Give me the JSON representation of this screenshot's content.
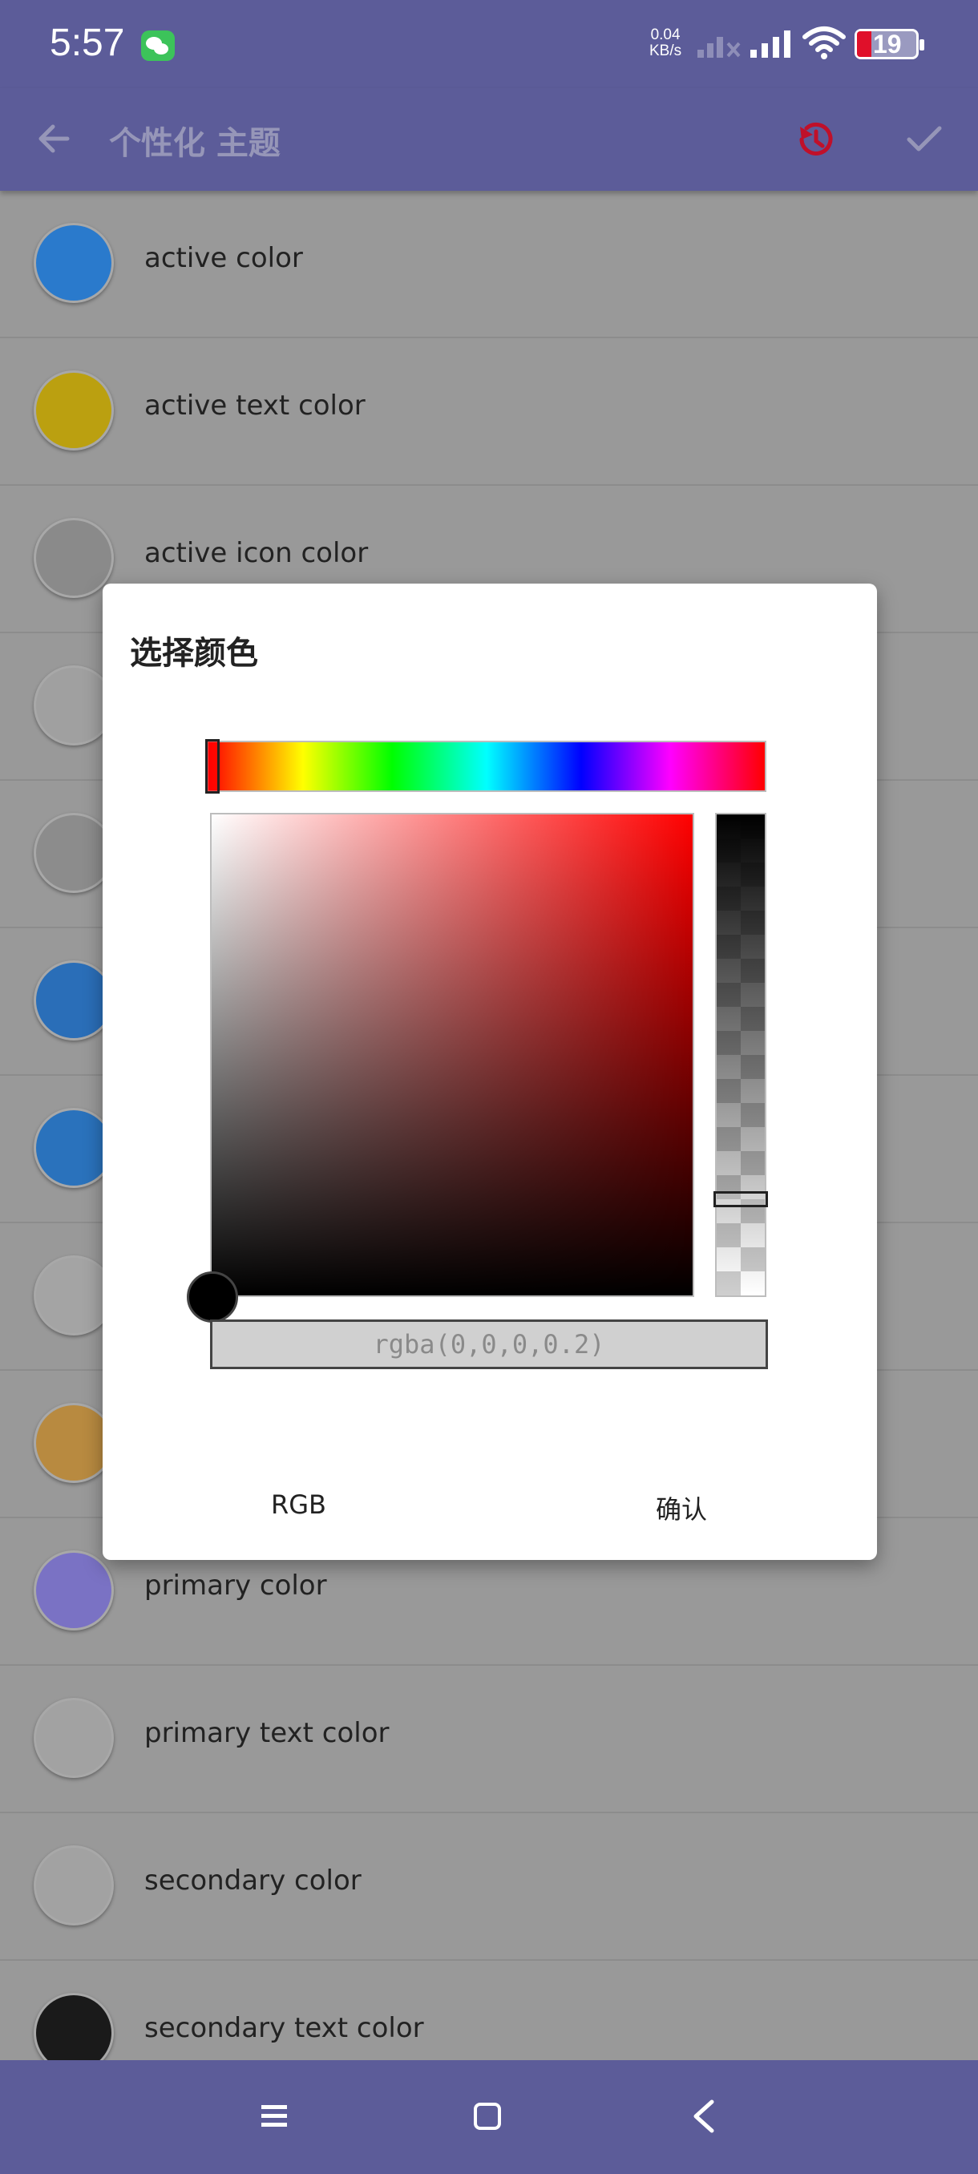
{
  "status_bar": {
    "time": "5:57",
    "net_speed_value": "0.04",
    "net_speed_unit": "KB/s",
    "battery": "19"
  },
  "app_bar": {
    "title": "个性化 主题",
    "icon_color": "#c0102a"
  },
  "list": [
    {
      "label": "active color",
      "color": "#2a7acc"
    },
    {
      "label": "active text color",
      "color": "#bba010"
    },
    {
      "label": "active icon color",
      "color": "#8a8a8a"
    },
    {
      "label": "",
      "color": "#a0a0a0"
    },
    {
      "label": "",
      "color": "#8c8c8c"
    },
    {
      "label": "",
      "color": "#2a6eb8"
    },
    {
      "label": "",
      "color": "#2a72bc"
    },
    {
      "label": "",
      "color": "#a4a4a4"
    },
    {
      "label": "",
      "color": "#b88a40"
    },
    {
      "label": "primary color",
      "color": "#7a72c4"
    },
    {
      "label": "primary text color",
      "color": "#a2a2a2"
    },
    {
      "label": "secondary color",
      "color": "#a2a2a2"
    },
    {
      "label": "secondary text color",
      "color": "#1a1a1a"
    }
  ],
  "dialog": {
    "title": "选择颜色",
    "color_value": "rgba(0,0,0,0.2)",
    "rgb_button": "RGB",
    "confirm_button": "确认"
  }
}
